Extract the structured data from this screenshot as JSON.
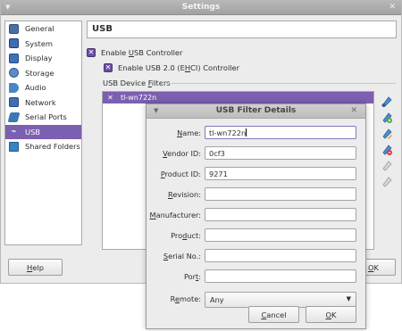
{
  "main": {
    "title": "Settings",
    "help_button": "Help",
    "ok_button": "OK"
  },
  "sidebar": {
    "items": [
      {
        "label": "General",
        "icon": "monitor-icon",
        "color": "#4a6fa5"
      },
      {
        "label": "System",
        "icon": "chip-icon",
        "color": "#3c6db0"
      },
      {
        "label": "Display",
        "icon": "display-icon",
        "color": "#3d72b8"
      },
      {
        "label": "Storage",
        "icon": "storage-icon",
        "color": "#5b8cc4"
      },
      {
        "label": "Audio",
        "icon": "speaker-icon",
        "color": "#4a86c6"
      },
      {
        "label": "Network",
        "icon": "network-icon",
        "color": "#3f6fae"
      },
      {
        "label": "Serial Ports",
        "icon": "serial-port-icon",
        "color": "#3b78b5"
      },
      {
        "label": "USB",
        "icon": "usb-icon",
        "color": "#ffffff",
        "active": true
      },
      {
        "label": "Shared Folders",
        "icon": "folder-icon",
        "color": "#3b82c4"
      }
    ]
  },
  "usb_page": {
    "header": "USB",
    "enable_usb": {
      "before": "Enable ",
      "underlined": "U",
      "after": "SB Controller",
      "checked": true
    },
    "enable_usb2": {
      "before": "Enable USB 2.0 (E",
      "underlined": "H",
      "after": "CI) Controller",
      "checked": true
    },
    "filters_label": {
      "before": "USB Device ",
      "underlined": "F",
      "after": "ilters"
    },
    "filters": [
      {
        "name": "tl-wn722n",
        "enabled": true
      }
    ]
  },
  "dialog": {
    "title": "USB Filter Details",
    "fields": {
      "name": {
        "label": "Name:",
        "value": "tl-wn722n"
      },
      "vendor_id": {
        "label": "Vendor ID:",
        "value": "0cf3"
      },
      "product_id": {
        "label": "Product ID:",
        "value": "9271"
      },
      "revision": {
        "label": "Revision:",
        "value": ""
      },
      "manufacturer": {
        "label": "Manufacturer:",
        "value": ""
      },
      "product": {
        "label": "Product:",
        "value": ""
      },
      "serial_no": {
        "label": "Serial No.:",
        "value": ""
      },
      "port": {
        "label": "Port:",
        "value": ""
      },
      "remote": {
        "label": "Remote:",
        "value": "Any"
      }
    },
    "cancel_button": "Cancel",
    "ok_button": "OK"
  },
  "colors": {
    "accent": "#7b5fb0",
    "checkbox": "#6a4ea3"
  }
}
